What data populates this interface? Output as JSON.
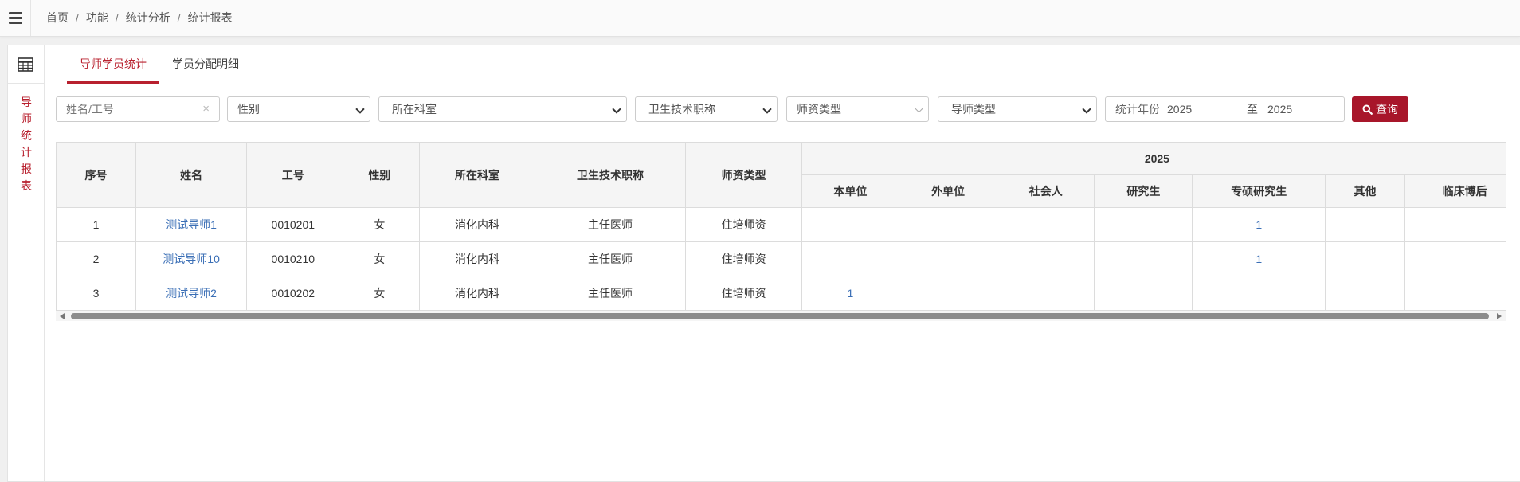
{
  "breadcrumb": [
    "首页",
    "功能",
    "统计分析",
    "统计报表"
  ],
  "side": {
    "title": "导师统计报表"
  },
  "tabs": [
    {
      "label": "导师学员统计",
      "active": true
    },
    {
      "label": "学员分配明细",
      "active": false
    }
  ],
  "filters": {
    "name_placeholder": "姓名/工号",
    "clear_symbol": "×",
    "gender": "性别",
    "department": "所在科室",
    "title": "卫生技术职称",
    "teacher_type": "师资类型",
    "mentor_type": "导师类型",
    "year_label": "统计年份",
    "year_from": "2025",
    "year_to_label": "至",
    "year_to": "2025",
    "query_button": "查询"
  },
  "table": {
    "fixed_headers": [
      "序号",
      "姓名",
      "工号",
      "性别",
      "所在科室",
      "卫生技术职称",
      "师资类型"
    ],
    "year_group": "2025",
    "sub_headers": [
      "本单位",
      "外单位",
      "社会人",
      "研究生",
      "专硕研究生",
      "其他",
      "临床博后"
    ],
    "rows": [
      {
        "index": "1",
        "name": "测试导师1",
        "id": "0010201",
        "gender": "女",
        "dept": "消化内科",
        "title": "主任医师",
        "type": "住培师资",
        "counts": [
          "",
          "",
          "",
          "",
          "1",
          "",
          ""
        ]
      },
      {
        "index": "2",
        "name": "测试导师10",
        "id": "0010210",
        "gender": "女",
        "dept": "消化内科",
        "title": "主任医师",
        "type": "住培师资",
        "counts": [
          "",
          "",
          "",
          "",
          "1",
          "",
          ""
        ]
      },
      {
        "index": "3",
        "name": "测试导师2",
        "id": "0010202",
        "gender": "女",
        "dept": "消化内科",
        "title": "主任医师",
        "type": "住培师资",
        "counts": [
          "1",
          "",
          "",
          "",
          "",
          "",
          ""
        ]
      }
    ]
  },
  "colors": {
    "accent": "#b8202e",
    "button": "#a8162a",
    "link": "#3b6fb6"
  }
}
